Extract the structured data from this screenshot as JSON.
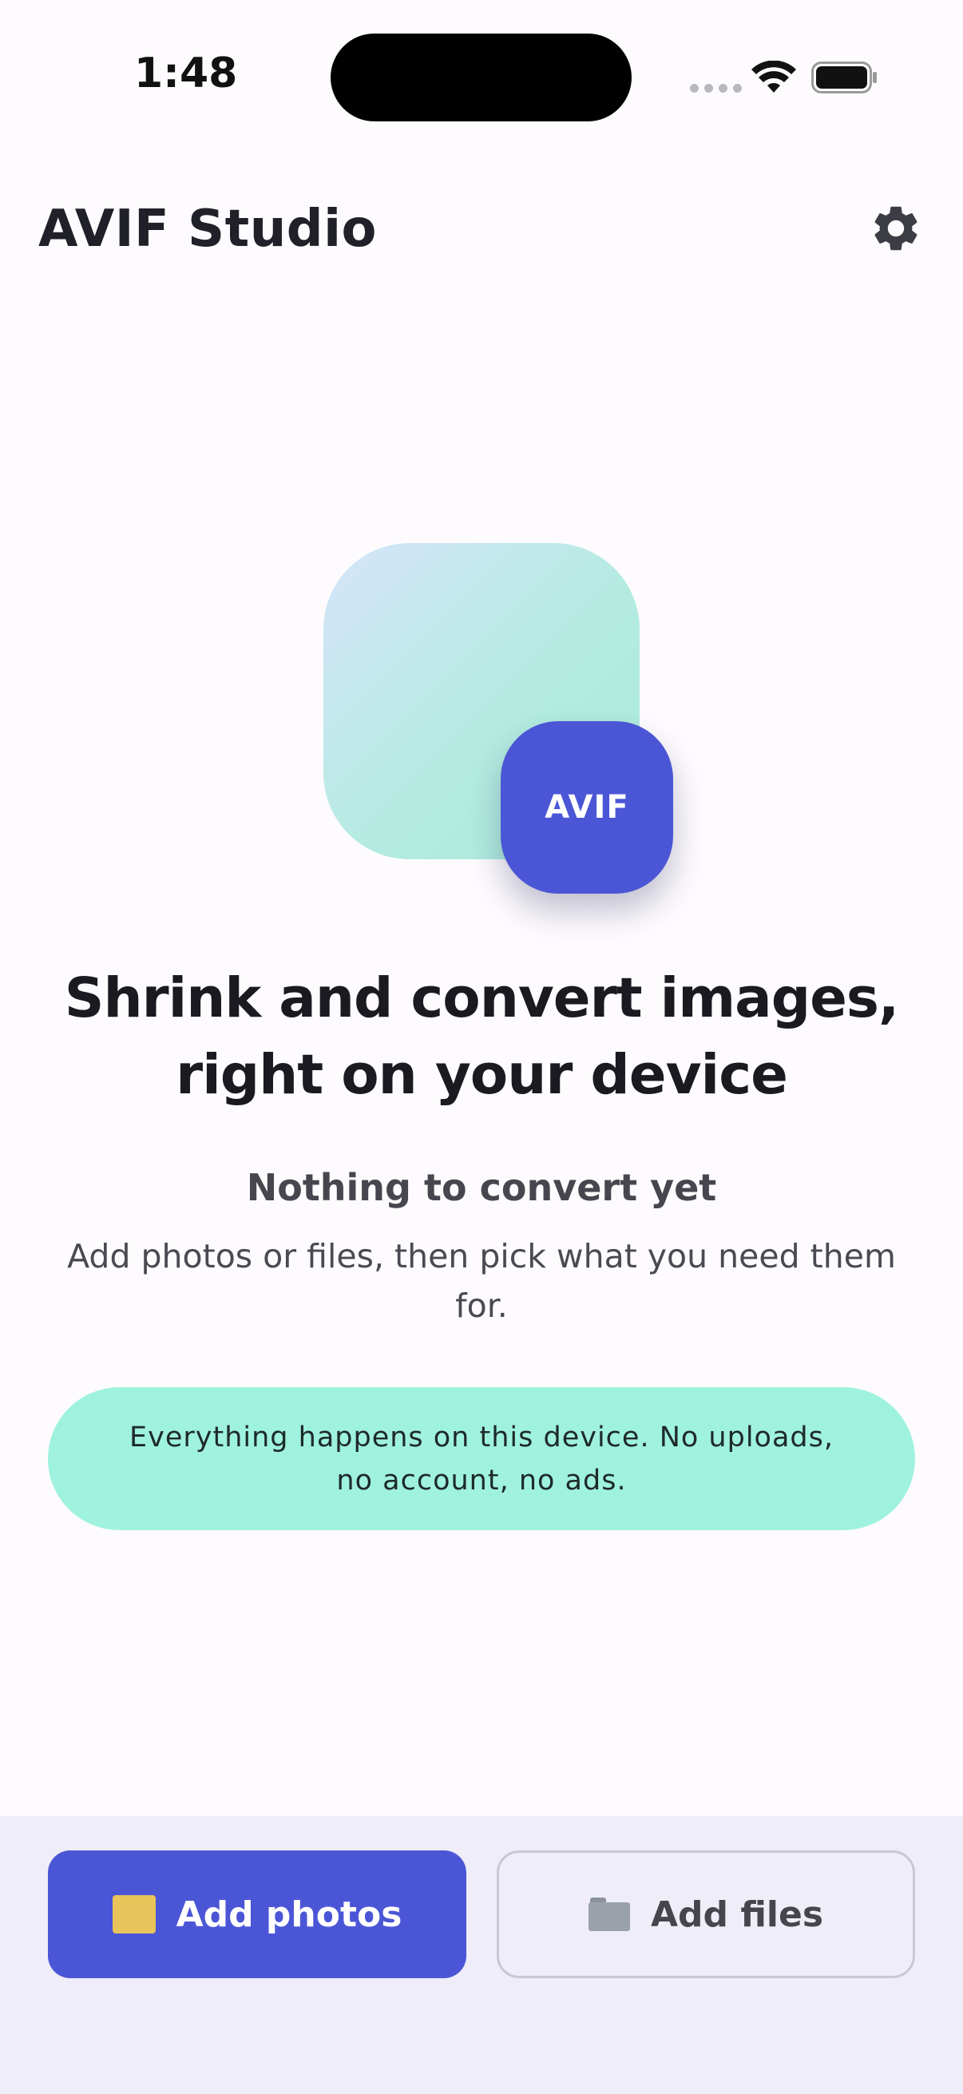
{
  "status_bar": {
    "time": "1:48"
  },
  "header": {
    "title": "AVIF Studio",
    "settings_icon": "gear-icon"
  },
  "hero": {
    "badge_label": "AVIF"
  },
  "main": {
    "headline": "Shrink and convert images, right on your device",
    "empty_title": "Nothing to convert yet",
    "empty_description": "Add photos or files, then pick what you need them for.",
    "privacy_note": "Everything happens on this device. No uploads, no account, no ads."
  },
  "actions": {
    "add_photos_label": "Add photos",
    "add_photos_icon": "framed-picture-icon",
    "add_files_label": "Add files",
    "add_files_icon": "folder-icon"
  },
  "colors": {
    "accent": "#4b56d6",
    "privacy_pill": "#9ff2de",
    "bottom_bar": "#eeedf8",
    "background": "#fdfbfd"
  }
}
